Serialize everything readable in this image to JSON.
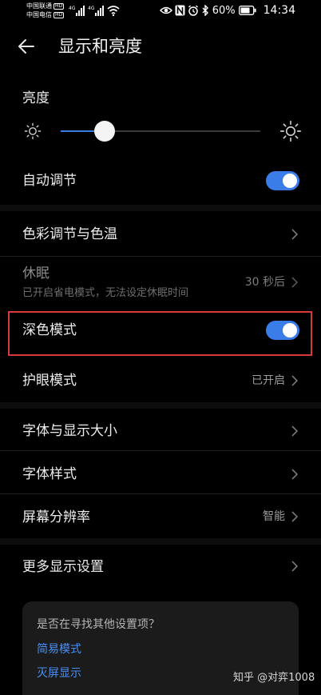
{
  "status_bar": {
    "carrier_1": "中国联通",
    "carrier_2": "中国电信",
    "hd_badge": "HD",
    "network_1": "4G",
    "network_2": "4G",
    "battery_percent": "60%",
    "time": "14:34",
    "icons": [
      "signal-icon",
      "wifi-icon",
      "eye-icon",
      "nfc-icon",
      "alarm-icon",
      "bluetooth-icon",
      "battery-icon"
    ]
  },
  "header": {
    "title": "显示和亮度"
  },
  "brightness": {
    "label": "亮度",
    "level_fraction": 0.22
  },
  "auto_adjust": {
    "label": "自动调节",
    "enabled": true
  },
  "color_temp": {
    "label": "色彩调节与色温"
  },
  "sleep": {
    "label": "休眠",
    "sublabel": "已开启省电模式，无法设定休眠时间",
    "value": "30 秒后"
  },
  "dark_mode": {
    "label": "深色模式",
    "enabled": true
  },
  "eye_comfort": {
    "label": "护眼模式",
    "value": "已开启"
  },
  "font_size": {
    "label": "字体与显示大小"
  },
  "font_style": {
    "label": "字体样式"
  },
  "resolution": {
    "label": "屏幕分辨率",
    "value": "智能"
  },
  "more_display": {
    "label": "更多显示设置"
  },
  "suggestions": {
    "title": "是否在寻找其他设置项？",
    "links": [
      "简易模式",
      "灭屏显示"
    ]
  },
  "watermark": "知乎 @对弈1008",
  "colors": {
    "accent": "#3a7de8",
    "link": "#4a8ff5",
    "highlight": "#d63a3a",
    "background": "#000000"
  }
}
